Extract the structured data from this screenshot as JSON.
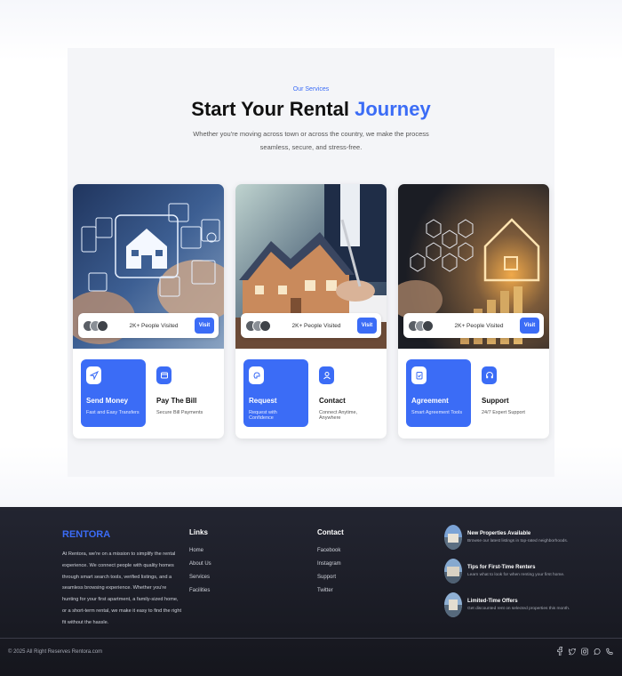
{
  "services": {
    "eyebrow": "Our Services",
    "title_main": "Start Your Rental",
    "title_accent": "Journey",
    "subtitle": "Whether you're moving across town or across the country, we make the process seamless, secure, and stress-free.",
    "cards": [
      {
        "visited": "2K+ People Visited",
        "visit_label": "Visit",
        "primary": {
          "title": "Send Money",
          "sub": "Fast and Easy Transfers",
          "icon": "send-icon"
        },
        "secondary": {
          "title": "Pay The Bill",
          "sub": "Secure Bill Payments",
          "icon": "bill-icon"
        }
      },
      {
        "visited": "2K+ People Visited",
        "visit_label": "Visit",
        "primary": {
          "title": "Request",
          "sub": "Request with Confidence",
          "icon": "request-icon"
        },
        "secondary": {
          "title": "Contact",
          "sub": "Connect Anytime, Anywhere",
          "icon": "contact-icon"
        }
      },
      {
        "visited": "2K+ People Visited",
        "visit_label": "Visit",
        "primary": {
          "title": "Agreement",
          "sub": "Smart Agreement Tools",
          "icon": "clipboard-icon"
        },
        "secondary": {
          "title": "Support",
          "sub": "24/7 Expert Support",
          "icon": "headset-icon"
        }
      }
    ]
  },
  "footer": {
    "brand": "RENTORA",
    "about": "At Rentora, we're on a mission to simplify the rental experience. We connect people with quality homes through smart search tools, verified listings, and a seamless browsing experience. Whether you're hunting for your first apartment, a family-sized home, or a short-term rental, we make it easy to find the right fit without the hassle.",
    "links_heading": "Links",
    "links": [
      "Home",
      "About Us",
      "Services",
      "Facilities"
    ],
    "contact_heading": "Contact",
    "contact": [
      "Facebook",
      "Instagram",
      "Support",
      "Twitter"
    ],
    "news": [
      {
        "title": "New Properties Available",
        "sub": "Browse our latest listings in top-rated neighborhoods."
      },
      {
        "title": "Tips for First-Time Renters",
        "sub": "Learn what to look for when renting your first home."
      },
      {
        "title": "Limited-Time Offers",
        "sub": "Get discounted rent on selected properties this month."
      }
    ],
    "copyright": "© 2025 All Right Reserves Rentora.com",
    "social_icons": [
      "facebook-icon",
      "twitter-icon",
      "instagram-icon",
      "whatsapp-icon",
      "phone-icon"
    ]
  },
  "colors": {
    "accent": "#3b6cf6",
    "footer_bg": "#1c1d25"
  }
}
